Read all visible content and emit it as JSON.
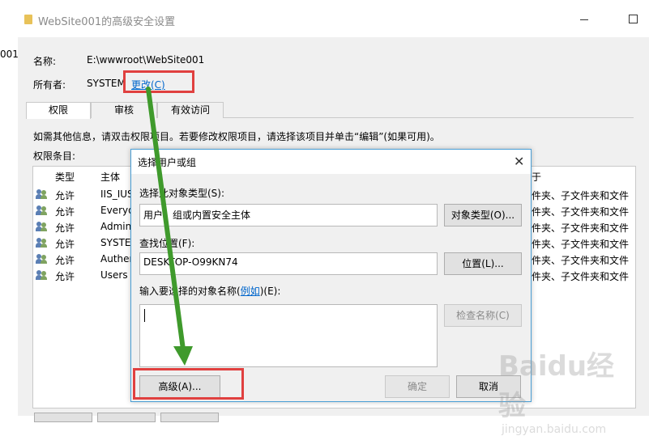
{
  "window": {
    "title": "WebSite001的高级安全设置",
    "left_strip_text": "001"
  },
  "properties": {
    "name_label": "名称:",
    "name_value": "E:\\wwwroot\\WebSite001",
    "owner_label": "所有者:",
    "owner_value": "SYSTEM",
    "change_link": "更改(C)"
  },
  "tabs": [
    {
      "label": "权限",
      "selected": true
    },
    {
      "label": "审核",
      "selected": false
    },
    {
      "label": "有效访问",
      "selected": false
    }
  ],
  "info_text": "如需其他信息，请双击权限项目。若要修改权限项目，请选择该项目并单击“编辑”(如果可用)。",
  "entries_label": "权限条目:",
  "permissions": {
    "headers": {
      "type": "类型",
      "principal": "主体",
      "applies": "于"
    },
    "rows": [
      {
        "type": "允许",
        "principal": "IIS_IUS",
        "applies": "件夹、子文件夹和文件"
      },
      {
        "type": "允许",
        "principal": "Everyo",
        "applies": "件夹、子文件夹和文件"
      },
      {
        "type": "允许",
        "principal": "Admini",
        "applies": "件夹、子文件夹和文件"
      },
      {
        "type": "允许",
        "principal": "SYSTEM",
        "applies": "件夹、子文件夹和文件"
      },
      {
        "type": "允许",
        "principal": "Authen",
        "applies": "件夹、子文件夹和文件"
      },
      {
        "type": "允许",
        "principal": "Users (",
        "applies": "件夹、子文件夹和文件"
      }
    ]
  },
  "dialog": {
    "title": "选择用户或组",
    "object_type_label": "选择此对象类型(S):",
    "object_type_value": "用户、组或内置安全主体",
    "object_types_button": "对象类型(O)...",
    "location_label": "查找位置(F):",
    "location_value": "DESKTOP-O99KN74",
    "locations_button": "位置(L)...",
    "names_label_before": "输入要选择的对象名称(",
    "names_label_link": "例如",
    "names_label_after": ")(E):",
    "names_value": "",
    "check_names_button": "检查名称(C)",
    "advanced_button": "高级(A)...",
    "ok_button": "确定",
    "cancel_button": "取消"
  },
  "watermark": {
    "text": "Baidu经验",
    "subtext": "jingyan.baidu.com"
  },
  "colors": {
    "highlight": "#e0403f",
    "arrow": "#3f9a2c",
    "link": "#0066cc",
    "dialog_border": "#4a9fd6"
  }
}
